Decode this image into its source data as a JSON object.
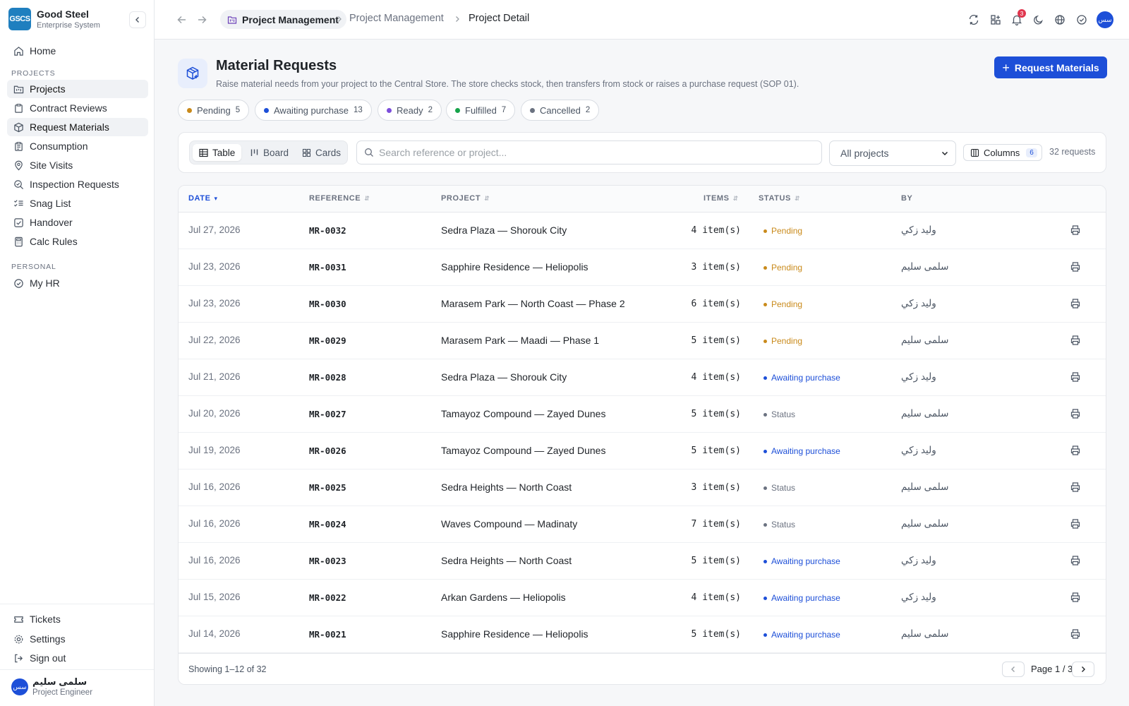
{
  "brand": {
    "logo": "GSCS",
    "name": "Good Steel",
    "subtitle": "Enterprise System"
  },
  "sidebar": {
    "home": "Home",
    "section_projects": "PROJECTS",
    "projects_items": [
      {
        "label": "Projects",
        "icon": "folder-kanban-icon"
      },
      {
        "label": "Contract Reviews",
        "icon": "clipboard-icon"
      },
      {
        "label": "Request Materials",
        "icon": "package-icon"
      },
      {
        "label": "Consumption",
        "icon": "clipboard-list-icon"
      },
      {
        "label": "Site Visits",
        "icon": "map-pin-icon"
      },
      {
        "label": "Inspection Requests",
        "icon": "search-check-icon"
      },
      {
        "label": "Snag List",
        "icon": "list-checks-icon"
      },
      {
        "label": "Handover",
        "icon": "square-check-icon"
      },
      {
        "label": "Calc Rules",
        "icon": "calculator-icon"
      }
    ],
    "section_personal": "PERSONAL",
    "personal_items": [
      {
        "label": "My HR",
        "icon": "circle-check-icon"
      }
    ],
    "footer_items": [
      {
        "label": "Tickets",
        "icon": "ticket-icon"
      },
      {
        "label": "Settings",
        "icon": "gear-icon"
      },
      {
        "label": "Sign out",
        "icon": "log-out-icon"
      }
    ],
    "user": {
      "avatar": "سس",
      "name": "سلمى سليم",
      "role": "Project Engineer"
    }
  },
  "topbar": {
    "breadcrumb_pill": "Project Management",
    "breadcrumb_mid": "Project Management",
    "breadcrumb_current": "Project Detail",
    "notification_count": "3",
    "avatar": "سس"
  },
  "page": {
    "title": "Material Requests",
    "subtitle": "Raise material needs from your project to the Central Store. The store checks stock, then transfers from stock or raises a purchase request (SOP 01).",
    "primary_button": "Request Materials"
  },
  "filters": [
    {
      "label": "Pending",
      "count": "5",
      "color": "#c98a1b"
    },
    {
      "label": "Awaiting purchase",
      "count": "13",
      "color": "#1d4fd8"
    },
    {
      "label": "Ready",
      "count": "2",
      "color": "#7c4ddb"
    },
    {
      "label": "Fulfilled",
      "count": "7",
      "color": "#16a34a"
    },
    {
      "label": "Cancelled",
      "count": "2",
      "color": "#6b7280"
    }
  ],
  "toolbar": {
    "views": [
      "Table",
      "Board",
      "Cards"
    ],
    "search_placeholder": "Search reference or project...",
    "project_filter": "All projects",
    "columns_label": "Columns",
    "columns_count": "6",
    "request_count": "32 requests"
  },
  "table": {
    "headers": {
      "date": "DATE",
      "reference": "REFERENCE",
      "project": "PROJECT",
      "items": "ITEMS",
      "status": "STATUS",
      "by": "BY"
    },
    "rows": [
      {
        "date": "Jul 27, 2026",
        "ref": "MR-0032",
        "project": "Sedra Plaza — Shorouk City",
        "items": "4 item(s)",
        "status": "Pending",
        "by": "وليد زكي"
      },
      {
        "date": "Jul 23, 2026",
        "ref": "MR-0031",
        "project": "Sapphire Residence — Heliopolis",
        "items": "3 item(s)",
        "status": "Pending",
        "by": "سلمى سليم"
      },
      {
        "date": "Jul 23, 2026",
        "ref": "MR-0030",
        "project": "Marasem Park — North Coast — Phase 2",
        "items": "6 item(s)",
        "status": "Pending",
        "by": "وليد زكي"
      },
      {
        "date": "Jul 22, 2026",
        "ref": "MR-0029",
        "project": "Marasem Park — Maadi — Phase 1",
        "items": "5 item(s)",
        "status": "Pending",
        "by": "سلمى سليم"
      },
      {
        "date": "Jul 21, 2026",
        "ref": "MR-0028",
        "project": "Sedra Plaza — Shorouk City",
        "items": "4 item(s)",
        "status": "Awaiting purchase",
        "by": "وليد زكي"
      },
      {
        "date": "Jul 20, 2026",
        "ref": "MR-0027",
        "project": "Tamayoz Compound — Zayed Dunes",
        "items": "5 item(s)",
        "status": "Status",
        "by": "سلمى سليم"
      },
      {
        "date": "Jul 19, 2026",
        "ref": "MR-0026",
        "project": "Tamayoz Compound — Zayed Dunes",
        "items": "5 item(s)",
        "status": "Awaiting purchase",
        "by": "وليد زكي"
      },
      {
        "date": "Jul 16, 2026",
        "ref": "MR-0025",
        "project": "Sedra Heights — North Coast",
        "items": "3 item(s)",
        "status": "Status",
        "by": "سلمى سليم"
      },
      {
        "date": "Jul 16, 2026",
        "ref": "MR-0024",
        "project": "Waves Compound — Madinaty",
        "items": "7 item(s)",
        "status": "Status",
        "by": "سلمى سليم"
      },
      {
        "date": "Jul 16, 2026",
        "ref": "MR-0023",
        "project": "Sedra Heights — North Coast",
        "items": "5 item(s)",
        "status": "Awaiting purchase",
        "by": "وليد زكي"
      },
      {
        "date": "Jul 15, 2026",
        "ref": "MR-0022",
        "project": "Arkan Gardens — Heliopolis",
        "items": "4 item(s)",
        "status": "Awaiting purchase",
        "by": "وليد زكي"
      },
      {
        "date": "Jul 14, 2026",
        "ref": "MR-0021",
        "project": "Sapphire Residence — Heliopolis",
        "items": "5 item(s)",
        "status": "Awaiting purchase",
        "by": "سلمى سليم"
      }
    ],
    "showing": "Showing 1–12 of 32",
    "page_label": "Page 1 / 3"
  },
  "colors": {
    "accent": "#1d4fd8",
    "pending": "#c98a1b",
    "awaiting": "#1d4fd8",
    "neutral": "#6b7280"
  }
}
